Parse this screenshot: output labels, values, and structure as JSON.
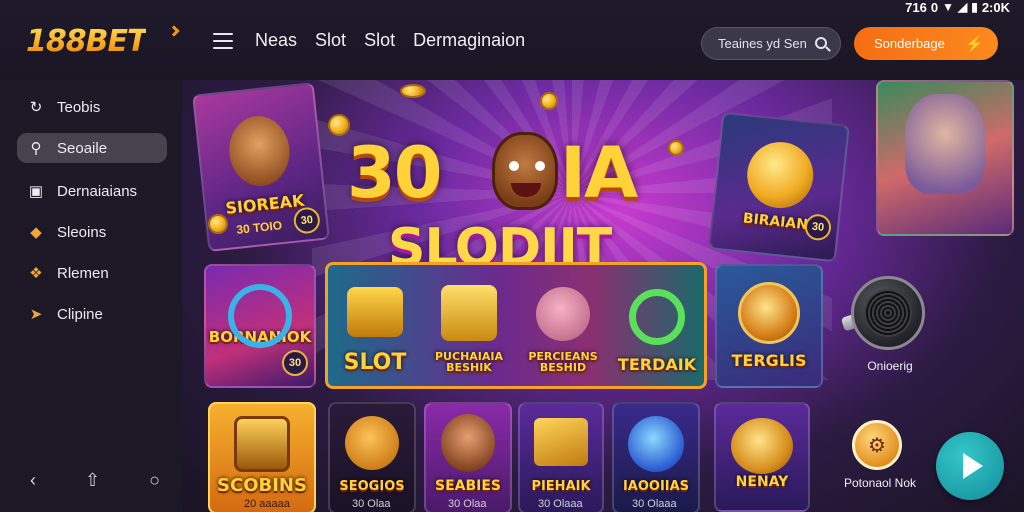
{
  "status_bar": {
    "left_text": "716",
    "signal_text": "0",
    "time": "2:0K"
  },
  "header": {
    "logo": "188BET",
    "nav": [
      "Neas",
      "Slot",
      "Slot",
      "Dermaginaion"
    ],
    "search": {
      "value": "Teaines yd Sen"
    },
    "cta_label": "Sonderbage"
  },
  "sidebar": {
    "items": [
      {
        "label": "Teobis",
        "icon": "refresh-icon",
        "active": false
      },
      {
        "label": "Seoaile",
        "icon": "search-icon",
        "active": true
      },
      {
        "label": "Dernaiaians",
        "icon": "folder-icon",
        "active": false
      },
      {
        "label": "Sleoins",
        "icon": "gem-icon",
        "active": false
      },
      {
        "label": "Rlemen",
        "icon": "ticket-icon",
        "active": false
      },
      {
        "label": "Clipine",
        "icon": "rocket-icon",
        "active": false
      }
    ],
    "bottom_icons": [
      "back-icon",
      "upload-icon",
      "chat-icon"
    ]
  },
  "hero": {
    "title_prefix": "30",
    "title_suffix": "IA",
    "title_word": "SLODIIT",
    "left_card": {
      "label": "SIOREAK",
      "sub": "30 TOIO",
      "badge": "30"
    },
    "right_card": {
      "label": "BIRAIAN",
      "badge": "30"
    }
  },
  "row1": {
    "left_card": {
      "label": "BORNANIOK",
      "badge": "30"
    },
    "strip": [
      {
        "label": "SLOT"
      },
      {
        "label": "PUCHAIAIA\nBESHIK"
      },
      {
        "label": "PERCIEANS\nBESHID"
      },
      {
        "label": "TERDAIK"
      }
    ],
    "right_card": {
      "label": "TERGLIS"
    },
    "mic_label": "Onioerig"
  },
  "row2": {
    "cards": [
      {
        "label": "SCOBINS",
        "sub": "20 aaaaa"
      },
      {
        "label": "SEOGIOS",
        "sub": "30 Olaa"
      },
      {
        "label": "SEABIES",
        "sub": "30 Olaa"
      },
      {
        "label": "PIEHAIK",
        "sub": "30 Olaaa"
      },
      {
        "label": "IAOOIIAS",
        "sub": "30 Olaaa"
      },
      {
        "label": "NENAY",
        "sub": ""
      }
    ],
    "promo_label": "Potonaol Nok"
  },
  "colors": {
    "accent": "#f77a1a",
    "brand_gold": "#ffd23a",
    "fab": "#1fa8b0"
  }
}
